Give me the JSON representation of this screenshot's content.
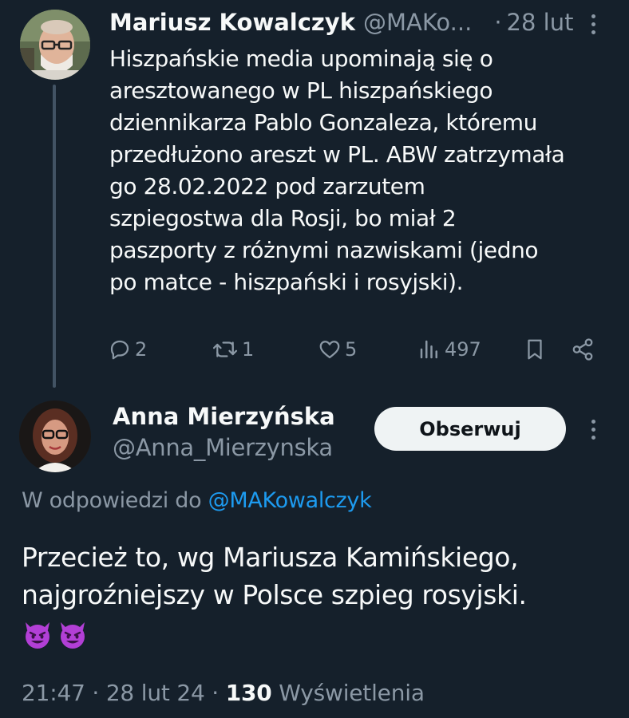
{
  "parent_tweet": {
    "author_name": "Mariusz Kowalczyk",
    "author_handle": "@MAKo...",
    "separator": "·",
    "date": "28 lut",
    "text": "Hiszpańskie media upominają się o aresztowanego w PL hiszpańskiego dziennikarza Pablo Gonzaleza, któremu przedłużono areszt w PL. ABW zatrzymała go 28.02.2022 pod zarzutem szpiegostwa dla Rosji, bo miał 2 paszporty z różnymi nazwiskami (jedno po matce - hiszpański i rosyjski).",
    "text_lines": [
      "Hiszpańskie media upominają się o",
      "aresztowanego w PL hiszpańskiego",
      "dziennikarza Pablo Gonzaleza, któremu",
      "przedłużono areszt w PL. ABW zatrzymała",
      "go 28.02.2022 pod zarzutem",
      "szpiegostwa dla Rosji, bo miał 2",
      "paszporty z różnymi nazwiskami (jedno",
      "po matce - hiszpański i rosyjski)."
    ],
    "actions": {
      "replies": "2",
      "reposts": "1",
      "likes": "5",
      "views": "497",
      "icons": [
        "reply-icon",
        "repost-icon",
        "like-icon",
        "views-icon",
        "bookmark-icon",
        "share-icon"
      ]
    }
  },
  "reply_tweet": {
    "author_name": "Anna Mierzyńska",
    "author_handle": "@Anna_Mierzynska",
    "follow_label": "Obserwuj",
    "reply_to_prefix": "W odpowiedzi do",
    "reply_to_handle": "@MAKowalczyk",
    "text_lines": [
      "Przecież to, wg Mariusza Kamińskiego,",
      "najgroźniejszy w Polsce szpieg rosyjski."
    ],
    "emojis": [
      "smiling-face-with-horns",
      "smiling-face-with-horns"
    ],
    "time": "21:47",
    "separator": "·",
    "date": "28 lut 24",
    "views_count": "130",
    "views_label": "Wyświetlenia"
  },
  "colors": {
    "background": "#15202b",
    "text_primary": "#f7f9f9",
    "text_secondary": "#8b98a5",
    "link": "#1d9bf0",
    "follow_button_bg": "#eff3f4",
    "thread_line": "#425364",
    "emoji_purple": "#b23fd6"
  }
}
